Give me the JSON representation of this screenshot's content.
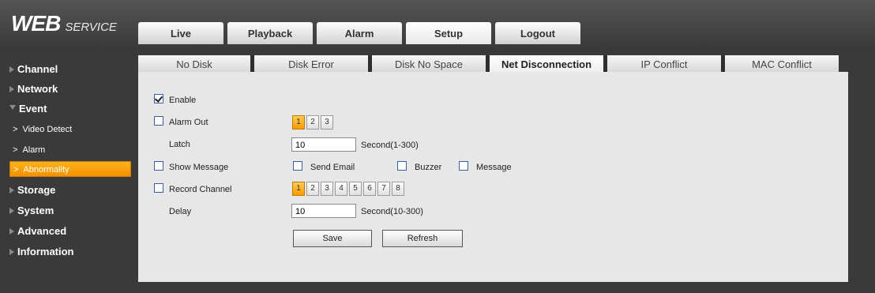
{
  "header": {
    "logo_main": "WEB",
    "logo_sub": "SERVICE"
  },
  "main_tabs": [
    {
      "label": "Live"
    },
    {
      "label": "Playback"
    },
    {
      "label": "Alarm"
    },
    {
      "label": "Setup",
      "active": true
    },
    {
      "label": "Logout"
    }
  ],
  "sidebar": {
    "items": [
      {
        "label": "Channel"
      },
      {
        "label": "Network"
      },
      {
        "label": "Event"
      },
      {
        "label": "Storage"
      },
      {
        "label": "System"
      },
      {
        "label": "Advanced"
      },
      {
        "label": "Information"
      }
    ],
    "sub_items": [
      {
        "label": "Video Detect"
      },
      {
        "label": "Alarm"
      },
      {
        "label": "Abnormality",
        "active": true
      }
    ],
    "chevron": ">"
  },
  "sub_tabs": [
    {
      "label": "No Disk"
    },
    {
      "label": "Disk Error"
    },
    {
      "label": "Disk No Space"
    },
    {
      "label": "Net Disconnection",
      "active": true
    },
    {
      "label": "IP Conflict"
    },
    {
      "label": "MAC Conflict"
    }
  ],
  "form": {
    "enable_label": "Enable",
    "enable_checked": true,
    "alarm_out_label": "Alarm Out",
    "alarm_out_numbers": [
      "1",
      "2",
      "3"
    ],
    "latch_label": "Latch",
    "latch_value": "10",
    "latch_unit": "Second(1-300)",
    "show_message_label": "Show Message",
    "send_email_label": "Send Email",
    "buzzer_label": "Buzzer",
    "message_label": "Message",
    "record_channel_label": "Record Channel",
    "record_channel_numbers": [
      "1",
      "2",
      "3",
      "4",
      "5",
      "6",
      "7",
      "8"
    ],
    "delay_label": "Delay",
    "delay_value": "10",
    "delay_unit": "Second(10-300)",
    "save_label": "Save",
    "refresh_label": "Refresh"
  },
  "colors": {
    "accent": "#f5a000",
    "panel_bg": "#e7e7e7",
    "frame_bg": "#3a3a3a"
  }
}
